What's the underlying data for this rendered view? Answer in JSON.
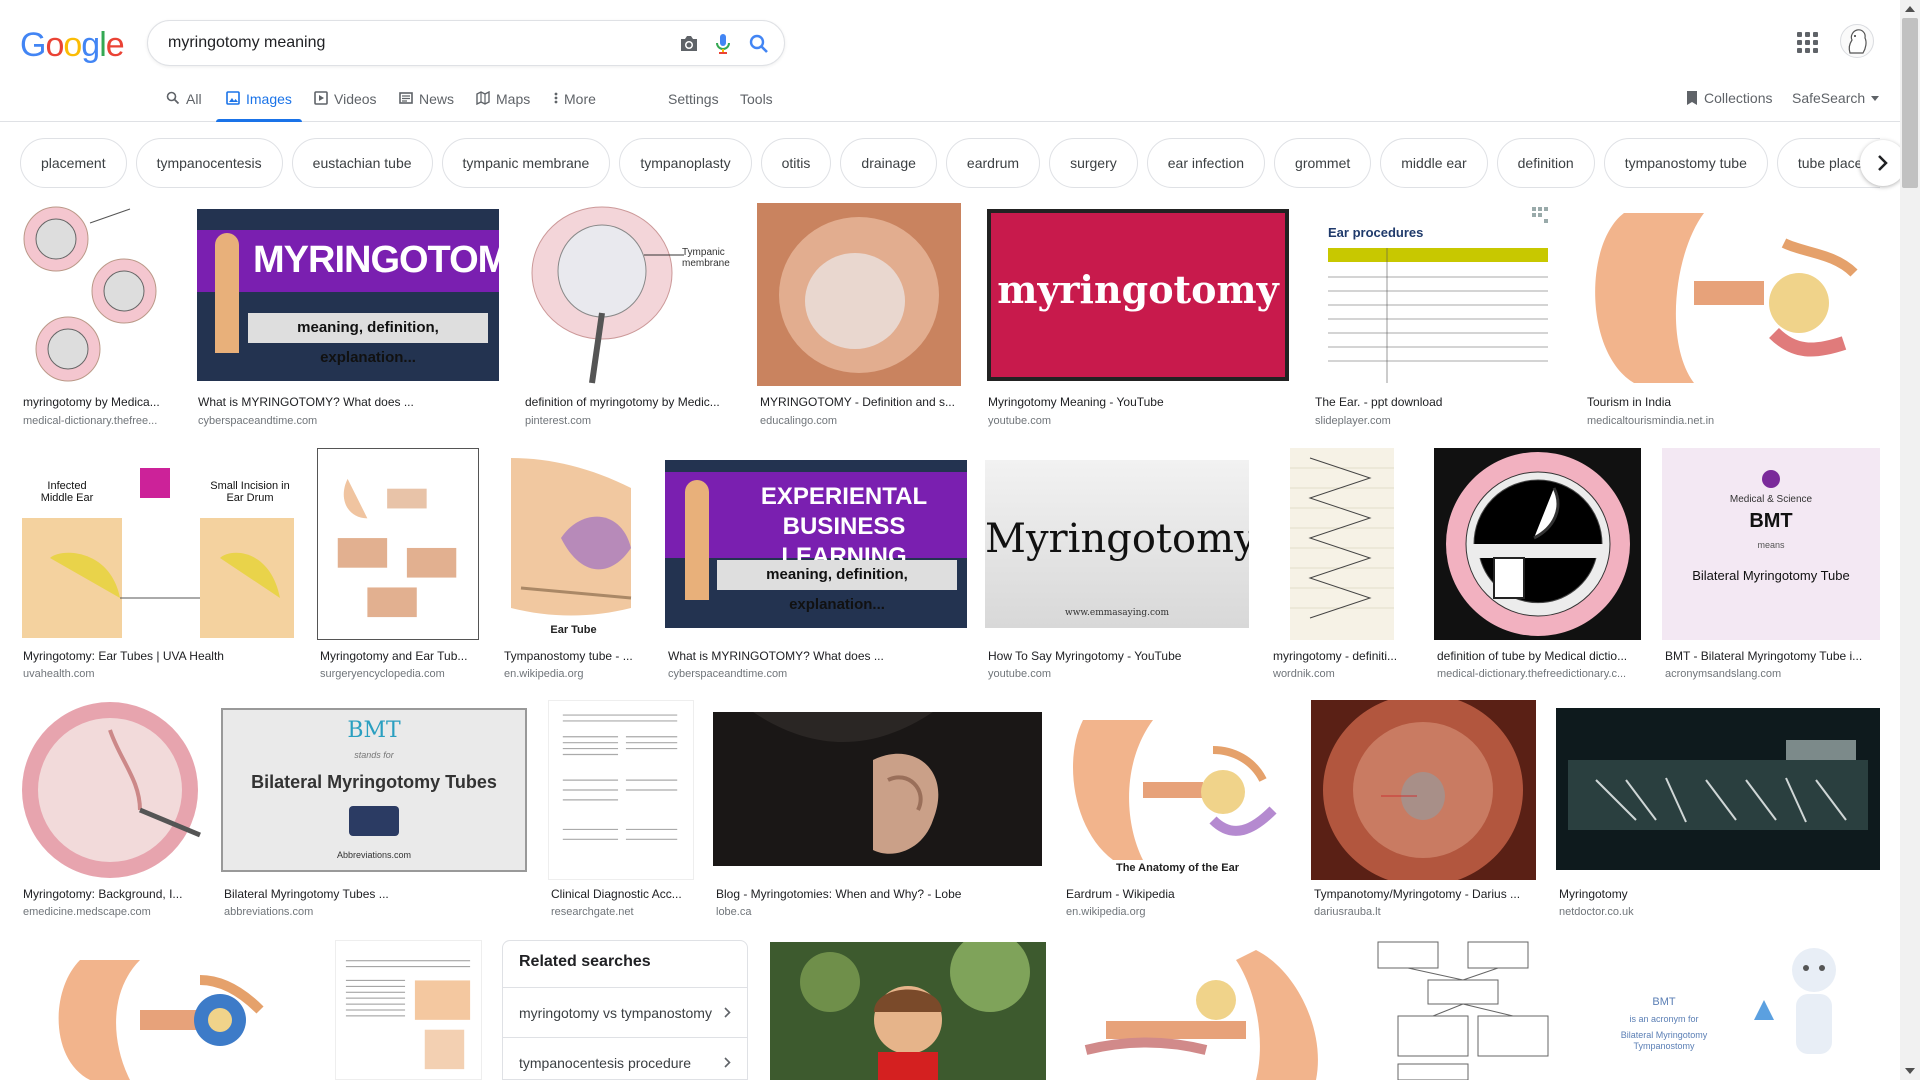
{
  "logo": {
    "letters": [
      "G",
      "o",
      "o",
      "g",
      "l",
      "e"
    ],
    "colors": [
      "#4285f4",
      "#ea4335",
      "#fbbc05",
      "#4285f4",
      "#34a853",
      "#ea4335"
    ]
  },
  "search": {
    "query": "myringotomy meaning"
  },
  "tabs": [
    {
      "label": "All",
      "icon": "search-icon"
    },
    {
      "label": "Images",
      "icon": "image-icon"
    },
    {
      "label": "Videos",
      "icon": "video-icon"
    },
    {
      "label": "News",
      "icon": "news-icon"
    },
    {
      "label": "Maps",
      "icon": "map-icon"
    },
    {
      "label": "More",
      "icon": "more-vert-icon"
    }
  ],
  "tools": {
    "settings": "Settings",
    "tools": "Tools"
  },
  "right": {
    "collections": "Collections",
    "safesearch": "SafeSearch"
  },
  "chips": [
    "placement",
    "tympanocentesis",
    "eustachian tube",
    "tympanic membrane",
    "tympanoplasty",
    "otitis",
    "drainage",
    "eardrum",
    "surgery",
    "ear infection",
    "grommet",
    "middle ear",
    "definition",
    "tympanostomy tube",
    "tube placement"
  ],
  "rows": [
    [
      {
        "title": "myringotomy by Medica...",
        "source": "medical-dictionary.thefree..."
      },
      {
        "title": "What is MYRINGOTOMY? What does ...",
        "source": "cyberspaceandtime.com",
        "caption1": "MYRINGOTOMY",
        "caption2": "meaning, definition, explanation..."
      },
      {
        "title": "definition of myringotomy by Medic...",
        "source": "pinterest.com",
        "caption1": "Tympanic membrane"
      },
      {
        "title": "MYRINGOTOMY - Definition and s...",
        "source": "educalingo.com"
      },
      {
        "title": "Myringotomy Meaning - YouTube",
        "source": "youtube.com",
        "caption1": "myringotomy"
      },
      {
        "title": "The Ear. - ppt download",
        "source": "slideplayer.com",
        "caption1": "Ear procedures"
      },
      {
        "title": "Tourism in India",
        "source": "medicaltourismindia.net.in"
      }
    ],
    [
      {
        "title": "Myringotomy: Ear Tubes | UVA Health",
        "source": "uvahealth.com",
        "caption1": "Infected Middle Ear",
        "caption2": "Small Incision in Ear Drum"
      },
      {
        "title": "Myringotomy and Ear Tub...",
        "source": "surgeryencyclopedia.com"
      },
      {
        "title": "Tympanostomy tube - ...",
        "source": "en.wikipedia.org",
        "caption1": "Ear Tube"
      },
      {
        "title": "What is MYRINGOTOMY? What does ...",
        "source": "cyberspaceandtime.com",
        "caption1": "EXPERIENTAL",
        "caption2": "BUSINESS LEARNING",
        "caption3": "meaning, definition, explanation..."
      },
      {
        "title": "How To Say Myringotomy - YouTube",
        "source": "youtube.com",
        "caption1": "Myringotomy",
        "caption2": "www.emmasaying.com"
      },
      {
        "title": "myringotomy - definiti...",
        "source": "wordnik.com"
      },
      {
        "title": "definition of tube by Medical dictio...",
        "source": "medical-dictionary.thefreedictionary.c..."
      },
      {
        "title": "BMT - Bilateral Myringotomy Tube i...",
        "source": "acronymsandslang.com",
        "caption1": "Medical & Science",
        "caption2": "BMT",
        "caption3": "means",
        "caption4": "Bilateral Myringotomy Tube"
      }
    ],
    [
      {
        "title": "Myringotomy: Background, I...",
        "source": "emedicine.medscape.com"
      },
      {
        "title": "Bilateral Myringotomy Tubes ...",
        "source": "abbreviations.com",
        "caption1": "BMT",
        "caption2": "stands for",
        "caption3": "Bilateral Myringotomy Tubes",
        "caption4": "Abbreviations.com"
      },
      {
        "title": "Clinical Diagnostic Acc...",
        "source": "researchgate.net"
      },
      {
        "title": "Blog - Myringotomies: When and Why? - Lobe",
        "source": "lobe.ca"
      },
      {
        "title": "Eardrum - Wikipedia",
        "source": "en.wikipedia.org",
        "caption1": "The Anatomy of the Ear"
      },
      {
        "title": "Tympanotomy/Myringotomy - Darius ...",
        "source": "dariusrauba.lt"
      },
      {
        "title": "Myringotomy",
        "source": "netdoctor.co.uk"
      }
    ]
  ],
  "related": {
    "heading": "Related searches",
    "items": [
      "myringotomy vs tympanostomy",
      "tympanocentesis procedure"
    ]
  },
  "row4": {
    "bmt_caption": "BMT",
    "bmt_line": "is an acronym for",
    "bmt_full": "Bilateral Myringotomy Tympanostomy"
  }
}
